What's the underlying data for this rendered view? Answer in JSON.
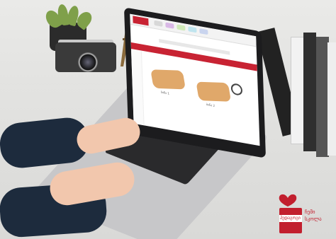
{
  "logo": {
    "box_text": "ჰედაგოგი",
    "side_text_1": "ჩემი",
    "side_text_2": "სკოლა"
  },
  "screen": {
    "card_left_caption": "ბინა 1",
    "card_right_caption": "ბინა 2"
  },
  "colors": {
    "brand_red": "#c82333",
    "card_orange": "#e0a86a",
    "sleeve_navy": "#1d2b3d"
  }
}
